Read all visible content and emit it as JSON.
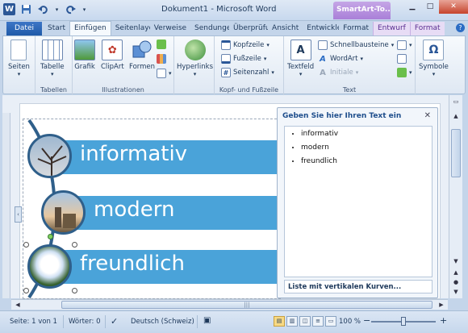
{
  "titlebar": {
    "title": "Dokument1 - Microsoft Word",
    "contextual_tab_group": "SmartArt-To...",
    "qat": {
      "app_icon": "W",
      "save_icon": "save-icon",
      "undo_icon": "undo-icon",
      "redo_icon": "redo-icon"
    }
  },
  "tabs": [
    {
      "label": "Datei"
    },
    {
      "label": "Start"
    },
    {
      "label": "Einfügen"
    },
    {
      "label": "Seitenlayo"
    },
    {
      "label": "Verweise"
    },
    {
      "label": "Sendunge"
    },
    {
      "label": "Überprüfu"
    },
    {
      "label": "Ansicht"
    },
    {
      "label": "Entwickle"
    },
    {
      "label": "Format"
    },
    {
      "label": "Entwurf"
    },
    {
      "label": "Format"
    }
  ],
  "ribbon": {
    "seiten": {
      "label": "Seiten"
    },
    "tabellen": {
      "button": "Tabelle",
      "group": "Tabellen"
    },
    "illustrationen": {
      "grafik": "Grafik",
      "clipart": "ClipArt",
      "formen": "Formen",
      "group": "Illustrationen"
    },
    "hyperlinks": {
      "label": "Hyperlinks"
    },
    "kopf": {
      "kopfzeile": "Kopfzeile",
      "fusszeile": "Fußzeile",
      "seitenzahl": "Seitenzahl",
      "group": "Kopf- und Fußzeile"
    },
    "text": {
      "textfeld": "Textfeld",
      "schnellbausteine": "Schnellbausteine",
      "wordart": "WordArt",
      "initiale": "Initiale",
      "group": "Text"
    },
    "symbole": {
      "label": "Symbole",
      "glyph": "Ω"
    }
  },
  "smartart": {
    "items": [
      {
        "text": "informativ"
      },
      {
        "text": "modern"
      },
      {
        "text": "freundlich"
      }
    ],
    "band_color": "#4aa3d9",
    "line_color": "#2f5f8a"
  },
  "text_pane": {
    "title": "Geben Sie hier Ihren Text ein",
    "items": [
      "informativ",
      "modern",
      "freundlich"
    ],
    "footer": "Liste mit vertikalen Kurven..."
  },
  "statusbar": {
    "page": "Seite: 1 von 1",
    "words": "Wörter: 0",
    "language": "Deutsch (Schweiz)",
    "zoom": "100 %",
    "zoom_minus": "−",
    "zoom_plus": "+"
  }
}
